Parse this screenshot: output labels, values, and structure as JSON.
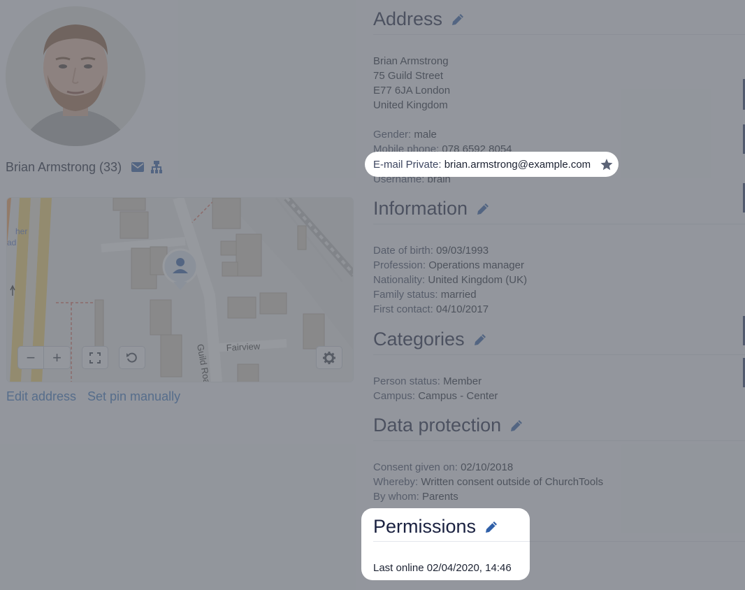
{
  "person": {
    "name_age": "Brian Armstrong (33)",
    "icons": [
      "envelope-icon",
      "org-tree-icon"
    ]
  },
  "map": {
    "street_labels": [
      "Guild Road",
      "Fairview"
    ],
    "partial_labels": [
      "her",
      "ad"
    ],
    "controls": [
      "zoom-out",
      "zoom-in",
      "fullscreen",
      "reset",
      "settings"
    ],
    "zoom_out_label": "−",
    "zoom_in_label": "+"
  },
  "links": {
    "edit_address": "Edit address",
    "set_pin": "Set pin manually"
  },
  "address": {
    "title": "Address",
    "lines": [
      "Brian Armstrong",
      "75 Guild Street",
      "E77 6JA London",
      "United Kingdom"
    ],
    "gender_label": "Gender:",
    "gender": "male",
    "mobile_label": "Mobile phone:",
    "mobile": "078 6592 8054",
    "email_label": "E-mail Private:",
    "email": "brian.armstrong@example.com",
    "username_label": "Username:",
    "username": "brain"
  },
  "information": {
    "title": "Information",
    "fields": [
      {
        "label": "Date of birth:",
        "value": "09/03/1993"
      },
      {
        "label": "Profession:",
        "value": "Operations manager"
      },
      {
        "label": "Nationality:",
        "value": "United Kingdom (UK)"
      },
      {
        "label": "Family status:",
        "value": "married"
      },
      {
        "label": "First contact:",
        "value": "04/10/2017"
      }
    ]
  },
  "categories": {
    "title": "Categories",
    "fields": [
      {
        "label": "Person status:",
        "value": "Member"
      },
      {
        "label": "Campus:",
        "value": "Campus - Center"
      }
    ]
  },
  "data_protection": {
    "title": "Data protection",
    "fields": [
      {
        "label": "Consent given on:",
        "value": "02/10/2018"
      },
      {
        "label": "Whereby:",
        "value": "Written consent outside of ChurchTools"
      },
      {
        "label": "By whom:",
        "value": "Parents"
      }
    ]
  },
  "permissions": {
    "title": "Permissions",
    "last_online": "Last online 02/04/2020, 14:46"
  },
  "colors": {
    "accent": "#2f5fa8",
    "link": "#3a76c4",
    "text": "#1a2140"
  }
}
